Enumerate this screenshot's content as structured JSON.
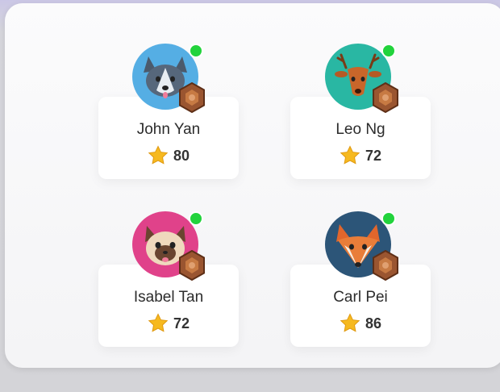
{
  "players": [
    {
      "name": "John Yan",
      "score": "80",
      "avatar": "husky-avatar",
      "status": "online",
      "bg": "#55aee4"
    },
    {
      "name": "Leo Ng",
      "score": "72",
      "avatar": "deer-avatar",
      "status": "online",
      "bg": "#29b7a3"
    },
    {
      "name": "Isabel Tan",
      "score": "72",
      "avatar": "cat-avatar",
      "status": "online",
      "bg": "#e0428a"
    },
    {
      "name": "Carl Pei",
      "score": "86",
      "avatar": "fox-avatar",
      "status": "online",
      "bg": "#2c5578"
    }
  ],
  "colors": {
    "online": "#22d33c",
    "star": "#f6b91f",
    "badge": "#9a5530"
  }
}
